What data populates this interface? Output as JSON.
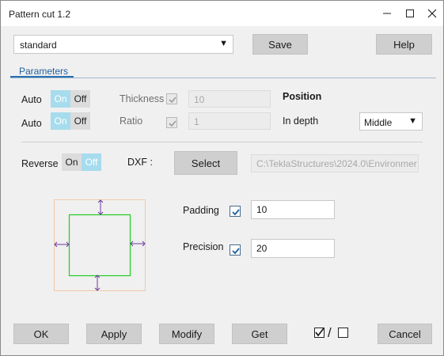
{
  "window": {
    "title": "Pattern cut 1.2"
  },
  "top": {
    "preset_value": "standard",
    "save_label": "Save",
    "help_label": "Help"
  },
  "tabs": [
    {
      "label": "Parameters"
    }
  ],
  "params": {
    "row1": {
      "auto_label": "Auto",
      "toggle_on": "On",
      "toggle_off": "Off",
      "field_label": "Thickness",
      "field_value": "10",
      "field_checked": true,
      "field_enabled": false
    },
    "row2": {
      "auto_label": "Auto",
      "toggle_on": "On",
      "toggle_off": "Off",
      "field_label": "Ratio",
      "field_value": "1",
      "field_checked": true,
      "field_enabled": false
    },
    "position_label": "Position",
    "in_depth_label": "In depth",
    "in_depth_value": "Middle",
    "reverse_label": "Reverse",
    "reverse_on": "On",
    "reverse_off": "Off",
    "reverse_state": "Off",
    "dxf_label": "DXF :",
    "select_label": "Select",
    "dxf_path": "C:\\TeklaStructures\\2024.0\\Environmer",
    "padding_label": "Padding",
    "padding_checked": true,
    "padding_value": "10",
    "precision_label": "Precision",
    "precision_checked": true,
    "precision_value": "20"
  },
  "footer": {
    "ok": "OK",
    "apply": "Apply",
    "modify": "Modify",
    "get": "Get",
    "toggle_all_sep": "/",
    "cancel": "Cancel"
  },
  "colors": {
    "toggle_active": "#a6dced",
    "diagram_inner": "#22cc22",
    "diagram_outer": "#f0c8a8",
    "diagram_arrow": "#6a3aa0",
    "tab_accent": "#2a6fb0"
  },
  "icons": {
    "minimize": "minimize-icon",
    "maximize": "maximize-icon",
    "close": "close-icon",
    "dropdown": "chevron-down-icon",
    "check": "checkmark-icon",
    "select_all": "checked-box-icon",
    "clear_all": "empty-box-icon"
  }
}
